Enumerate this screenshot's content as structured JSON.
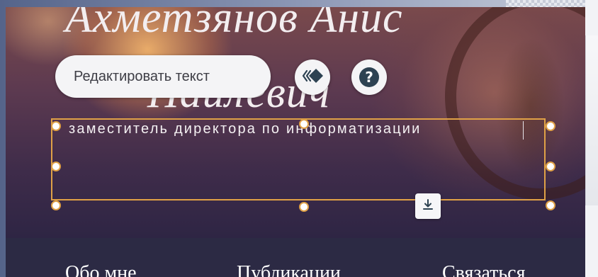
{
  "hero": {
    "name_line1": "Ахметзянов Анис",
    "name_line2": "Наилевич",
    "subtitle": "заместитель директора по информатизации"
  },
  "editor_toolbar": {
    "edit_text_label": "Редактировать текст",
    "animation_icon": "animation-icon",
    "help_icon": "help-icon",
    "help_symbol": "?",
    "download_icon": "download-icon"
  },
  "nav": {
    "items": [
      {
        "label": "Обо мне"
      },
      {
        "label": "Публикации"
      },
      {
        "label": "Связаться"
      }
    ]
  },
  "colors": {
    "selection": "#e0a146",
    "navbar": "#2c2a44",
    "help_button": "#2d4252"
  }
}
